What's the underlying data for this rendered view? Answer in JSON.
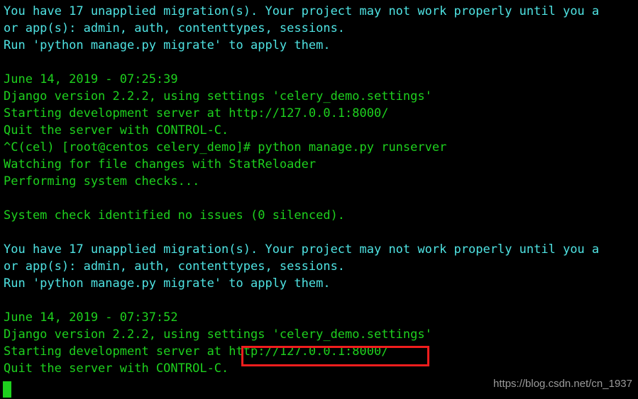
{
  "terminal": {
    "background_color": "#000000",
    "cyan_color": "#4fe3e3",
    "green_color": "#1ed11e",
    "highlight_color": "#f01d1d",
    "cursor_color": "#1ed11e",
    "watermark_color": "#9a9a9a",
    "lines": [
      {
        "text": "You have 17 unapplied migration(s). Your project may not work properly until you a",
        "color": "cyan"
      },
      {
        "text": "or app(s): admin, auth, contenttypes, sessions.",
        "color": "cyan"
      },
      {
        "text": "Run 'python manage.py migrate' to apply them.",
        "color": "cyan"
      },
      {
        "text": "",
        "color": "blank"
      },
      {
        "text": "June 14, 2019 - 07:25:39",
        "color": "green"
      },
      {
        "text": "Django version 2.2.2, using settings 'celery_demo.settings'",
        "color": "green"
      },
      {
        "text": "Starting development server at http://127.0.0.1:8000/",
        "color": "green"
      },
      {
        "text": "Quit the server with CONTROL-C.",
        "color": "green"
      },
      {
        "text": "^C(cel) [root@centos celery_demo]# python manage.py runserver",
        "color": "green"
      },
      {
        "text": "Watching for file changes with StatReloader",
        "color": "green"
      },
      {
        "text": "Performing system checks...",
        "color": "green"
      },
      {
        "text": "",
        "color": "blank"
      },
      {
        "text": "System check identified no issues (0 silenced).",
        "color": "green"
      },
      {
        "text": "",
        "color": "blank"
      },
      {
        "text": "You have 17 unapplied migration(s). Your project may not work properly until you a",
        "color": "cyan"
      },
      {
        "text": "or app(s): admin, auth, contenttypes, sessions.",
        "color": "cyan"
      },
      {
        "text": "Run 'python manage.py migrate' to apply them.",
        "color": "cyan"
      },
      {
        "text": "",
        "color": "blank"
      },
      {
        "text": "June 14, 2019 - 07:37:52",
        "color": "green"
      },
      {
        "text": "Django version 2.2.2, using settings 'celery_demo.settings'",
        "color": "green"
      },
      {
        "text": "Starting development server at http://127.0.0.1:8000/",
        "color": "green"
      },
      {
        "text": "Quit the server with CONTROL-C.",
        "color": "green"
      }
    ],
    "highlighted_url": "http://127.0.0.1:8000/",
    "prompt": "(cel) [root@centos celery_demo]#",
    "command": "python manage.py runserver",
    "django_version": "2.2.2",
    "settings_module": "celery_demo.settings",
    "migration_count": "17",
    "apps": "admin, auth, contenttypes, sessions",
    "timestamps": [
      "June 14, 2019 - 07:25:39",
      "June 14, 2019 - 07:37:52"
    ],
    "cursor": "block-cursor"
  },
  "watermark": {
    "text": "https://blog.csdn.net/cn_1937"
  }
}
